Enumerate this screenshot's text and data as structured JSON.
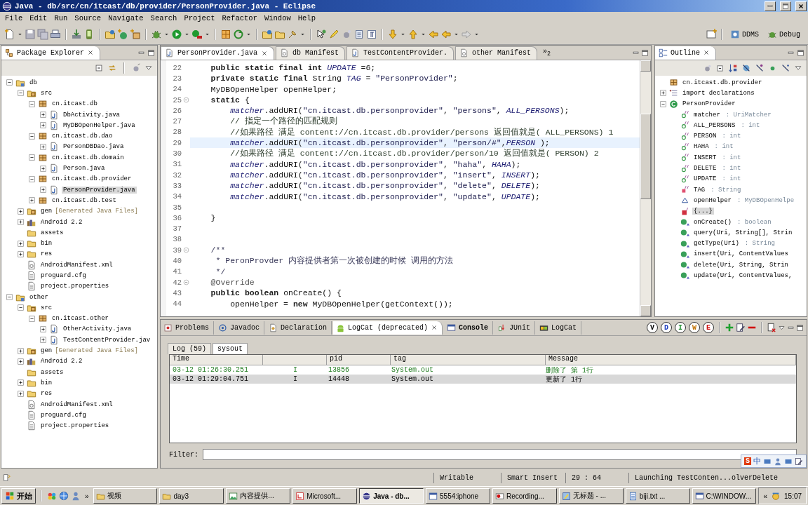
{
  "window": {
    "title": "Java - db/src/cn/itcast/db/provider/PersonProvider.java - Eclipse"
  },
  "menu": [
    "File",
    "Edit",
    "Run",
    "Source",
    "Navigate",
    "Search",
    "Project",
    "Refactor",
    "Window",
    "Help"
  ],
  "perspectives": [
    {
      "label": "DDMS",
      "kind": "ddms",
      "selected": false
    },
    {
      "label": "Debug",
      "kind": "debug",
      "selected": false
    }
  ],
  "package_explorer": {
    "title": "Package Explorer",
    "tree": [
      {
        "label": "db",
        "kind": "project",
        "expanded": true,
        "selected": false,
        "children": [
          {
            "label": "src",
            "kind": "srcfolder",
            "expanded": true,
            "selected": false,
            "children": [
              {
                "label": "cn.itcast.db",
                "kind": "package",
                "expanded": true,
                "selected": false,
                "children": [
                  {
                    "label": "DbActivity.java",
                    "kind": "java",
                    "expanded": false,
                    "selected": false
                  },
                  {
                    "label": "MyDBOpenHelper.java",
                    "kind": "java",
                    "expanded": false,
                    "selected": false
                  }
                ]
              },
              {
                "label": "cn.itcast.db.dao",
                "kind": "package",
                "expanded": true,
                "selected": false,
                "children": [
                  {
                    "label": "PersonDBDao.java",
                    "kind": "java",
                    "expanded": false,
                    "selected": false
                  }
                ]
              },
              {
                "label": "cn.itcast.db.domain",
                "kind": "package",
                "expanded": true,
                "selected": false,
                "children": [
                  {
                    "label": "Person.java",
                    "kind": "java",
                    "expanded": false,
                    "selected": false
                  }
                ]
              },
              {
                "label": "cn.itcast.db.provider",
                "kind": "package",
                "expanded": true,
                "selected": false,
                "children": [
                  {
                    "label": "PersonProvider.java",
                    "kind": "java",
                    "expanded": false,
                    "selected": true
                  }
                ]
              },
              {
                "label": "cn.itcast.db.test",
                "kind": "package",
                "expanded": false,
                "selected": false
              }
            ]
          },
          {
            "label": "gen",
            "note": "[Generated Java Files]",
            "kind": "srcfolder",
            "expanded": false,
            "selected": false
          },
          {
            "label": "Android 2.2",
            "kind": "library",
            "expanded": false,
            "selected": false
          },
          {
            "label": "assets",
            "kind": "folder",
            "selected": false
          },
          {
            "label": "bin",
            "kind": "folder",
            "expanded": false,
            "selected": false
          },
          {
            "label": "res",
            "kind": "folder",
            "expanded": false,
            "selected": false
          },
          {
            "label": "AndroidManifest.xml",
            "kind": "xml",
            "selected": false
          },
          {
            "label": "proguard.cfg",
            "kind": "file",
            "selected": false
          },
          {
            "label": "project.properties",
            "kind": "file",
            "selected": false
          }
        ]
      },
      {
        "label": "other",
        "kind": "project",
        "expanded": true,
        "selected": false,
        "children": [
          {
            "label": "src",
            "kind": "srcfolder",
            "expanded": true,
            "selected": false,
            "children": [
              {
                "label": "cn.itcast.other",
                "kind": "package",
                "expanded": true,
                "selected": false,
                "children": [
                  {
                    "label": "OtherActivity.java",
                    "kind": "java",
                    "expanded": false,
                    "selected": false
                  },
                  {
                    "label": "TestContentProvider.jav",
                    "kind": "java",
                    "expanded": false,
                    "selected": false
                  }
                ]
              }
            ]
          },
          {
            "label": "gen",
            "note": "[Generated Java Files]",
            "kind": "srcfolder",
            "expanded": false,
            "selected": false
          },
          {
            "label": "Android 2.2",
            "kind": "library",
            "expanded": false,
            "selected": false
          },
          {
            "label": "assets",
            "kind": "folder",
            "selected": false
          },
          {
            "label": "bin",
            "kind": "folder",
            "expanded": false,
            "selected": false
          },
          {
            "label": "res",
            "kind": "folder",
            "expanded": false,
            "selected": false
          },
          {
            "label": "AndroidManifest.xml",
            "kind": "xml",
            "selected": false
          },
          {
            "label": "proguard.cfg",
            "kind": "file",
            "selected": false
          },
          {
            "label": "project.properties",
            "kind": "file",
            "selected": false
          }
        ]
      }
    ]
  },
  "editor": {
    "tabs": [
      {
        "label": "PersonProvider.java",
        "kind": "java",
        "selected": true
      },
      {
        "label": "db Manifest",
        "kind": "xml",
        "selected": false
      },
      {
        "label": "TestContentProvider.",
        "kind": "java",
        "selected": false
      },
      {
        "label": "other Manifest",
        "kind": "xml",
        "selected": false
      }
    ],
    "overflow": "»$_{2}$",
    "lines": [
      {
        "number": "22",
        "foldable": false,
        "current": false,
        "segments": [
          {
            "text": "    public static final int ",
            "kind": "keyword"
          },
          {
            "text": "UPDATE",
            "kind": "field"
          },
          {
            "text": " =6;",
            "kind": "plain"
          }
        ]
      },
      {
        "number": "23",
        "foldable": false,
        "current": false,
        "segments": [
          {
            "text": "    private static final ",
            "kind": "keyword"
          },
          {
            "text": "String ",
            "kind": "plain"
          },
          {
            "text": "TAG",
            "kind": "field"
          },
          {
            "text": " = ",
            "kind": "plain"
          },
          {
            "text": "\"PersonProvider\"",
            "kind": "string"
          },
          {
            "text": ";",
            "kind": "plain"
          }
        ]
      },
      {
        "number": "24",
        "foldable": false,
        "current": false,
        "segments": [
          {
            "text": "    MyDBOpenHelper openHelper;",
            "kind": "plain"
          }
        ]
      },
      {
        "number": "25",
        "foldable": true,
        "current": false,
        "segments": [
          {
            "text": "    static",
            "kind": "keyword"
          },
          {
            "text": " {",
            "kind": "plain"
          }
        ]
      },
      {
        "number": "26",
        "foldable": false,
        "current": false,
        "segments": [
          {
            "text": "        matcher",
            "kind": "field"
          },
          {
            "text": ".addURI(",
            "kind": "plain"
          },
          {
            "text": "\"cn.itcast.db.personprovider\"",
            "kind": "string"
          },
          {
            "text": ", ",
            "kind": "plain"
          },
          {
            "text": "\"persons\"",
            "kind": "string"
          },
          {
            "text": ", ",
            "kind": "plain"
          },
          {
            "text": "ALL_PERSONS",
            "kind": "field"
          },
          {
            "text": ");",
            "kind": "plain"
          }
        ]
      },
      {
        "number": "27",
        "foldable": false,
        "current": false,
        "segments": [
          {
            "text": "        // 指定一个路径的匹配规则",
            "kind": "comment"
          }
        ]
      },
      {
        "number": "28",
        "foldable": false,
        "current": false,
        "segments": [
          {
            "text": "        //如果路径 满足 content://cn.itcast.db.provider/persons 返回值就是( ALL_PERSONS) 1",
            "kind": "comment"
          }
        ]
      },
      {
        "number": "29",
        "foldable": false,
        "current": true,
        "segments": [
          {
            "text": "        matcher",
            "kind": "field"
          },
          {
            "text": ".addURI(",
            "kind": "plain"
          },
          {
            "text": "\"cn.itcast.db.personprovider\"",
            "kind": "string"
          },
          {
            "text": ", ",
            "kind": "plain"
          },
          {
            "text": "\"person/#\"",
            "kind": "string"
          },
          {
            "text": ",",
            "kind": "plain"
          },
          {
            "text": "PERSON",
            "kind": "field"
          },
          {
            "text": " );",
            "kind": "plain"
          }
        ]
      },
      {
        "number": "30",
        "foldable": false,
        "current": false,
        "segments": [
          {
            "text": "        //如果路径 满足 content://cn.itcast.db.provider/person/10 返回值就是( PERSON) 2",
            "kind": "comment"
          }
        ]
      },
      {
        "number": "31",
        "foldable": false,
        "current": false,
        "segments": [
          {
            "text": "        matcher",
            "kind": "field"
          },
          {
            "text": ".addURI(",
            "kind": "plain"
          },
          {
            "text": "\"cn.itcast.db.personprovider\"",
            "kind": "string"
          },
          {
            "text": ", ",
            "kind": "plain"
          },
          {
            "text": "\"haha\"",
            "kind": "string"
          },
          {
            "text": ", ",
            "kind": "plain"
          },
          {
            "text": "HAHA",
            "kind": "field"
          },
          {
            "text": ");",
            "kind": "plain"
          }
        ]
      },
      {
        "number": "32",
        "foldable": false,
        "current": false,
        "segments": [
          {
            "text": "        matcher",
            "kind": "field"
          },
          {
            "text": ".addURI(",
            "kind": "plain"
          },
          {
            "text": "\"cn.itcast.db.personprovider\"",
            "kind": "string"
          },
          {
            "text": ", ",
            "kind": "plain"
          },
          {
            "text": "\"insert\"",
            "kind": "string"
          },
          {
            "text": ", ",
            "kind": "plain"
          },
          {
            "text": "INSERT",
            "kind": "field"
          },
          {
            "text": ");",
            "kind": "plain"
          }
        ]
      },
      {
        "number": "33",
        "foldable": false,
        "current": false,
        "segments": [
          {
            "text": "        matcher",
            "kind": "field"
          },
          {
            "text": ".addURI(",
            "kind": "plain"
          },
          {
            "text": "\"cn.itcast.db.personprovider\"",
            "kind": "string"
          },
          {
            "text": ", ",
            "kind": "plain"
          },
          {
            "text": "\"delete\"",
            "kind": "string"
          },
          {
            "text": ", ",
            "kind": "plain"
          },
          {
            "text": "DELETE",
            "kind": "field"
          },
          {
            "text": ");",
            "kind": "plain"
          }
        ]
      },
      {
        "number": "34",
        "foldable": false,
        "current": false,
        "segments": [
          {
            "text": "        matcher",
            "kind": "field"
          },
          {
            "text": ".addURI(",
            "kind": "plain"
          },
          {
            "text": "\"cn.itcast.db.personprovider\"",
            "kind": "string"
          },
          {
            "text": ", ",
            "kind": "plain"
          },
          {
            "text": "\"update\"",
            "kind": "string"
          },
          {
            "text": ", ",
            "kind": "plain"
          },
          {
            "text": "UPDATE",
            "kind": "field"
          },
          {
            "text": ");",
            "kind": "plain"
          }
        ]
      },
      {
        "number": "35",
        "foldable": false,
        "current": false
      },
      {
        "number": "36",
        "foldable": false,
        "current": false,
        "segments": [
          {
            "text": "    }",
            "kind": "plain"
          }
        ]
      },
      {
        "number": "37",
        "foldable": false,
        "current": false
      },
      {
        "number": "38",
        "foldable": false,
        "current": false
      },
      {
        "number": "39",
        "foldable": true,
        "current": false,
        "segments": [
          {
            "text": "    /**",
            "kind": "javadoc"
          }
        ]
      },
      {
        "number": "40",
        "foldable": false,
        "current": false,
        "segments": [
          {
            "text": "     * PeronProvder 内容提供者第一次被创建的时候 调用的方法",
            "kind": "javadoc"
          }
        ]
      },
      {
        "number": "41",
        "foldable": false,
        "current": false,
        "segments": [
          {
            "text": "     */",
            "kind": "javadoc"
          }
        ]
      },
      {
        "number": "42",
        "foldable": true,
        "current": false,
        "segments": [
          {
            "text": "    @Override",
            "kind": "annotation"
          }
        ]
      },
      {
        "number": "43",
        "foldable": false,
        "current": false,
        "segments": [
          {
            "text": "    public boolean ",
            "kind": "keyword"
          },
          {
            "text": "onCreate() {",
            "kind": "plain"
          }
        ]
      },
      {
        "number": "44",
        "foldable": false,
        "current": false,
        "segments": [
          {
            "text": "        openHelper = ",
            "kind": "plain"
          },
          {
            "text": "new ",
            "kind": "keyword"
          },
          {
            "text": "MyDBOpenHelper(getContext());",
            "kind": "plain"
          }
        ]
      }
    ]
  },
  "outline": {
    "title": "Outline",
    "items": [
      {
        "label": "cn.itcast.db.provider",
        "kind": "package",
        "selected": false
      },
      {
        "label": "import declarations",
        "kind": "imports",
        "expanded": false,
        "selected": false
      },
      {
        "label": "PersonProvider",
        "kind": "class",
        "expanded": true,
        "selected": false,
        "children": [
          {
            "label": "matcher",
            "type": ": UriMatcher",
            "kind": "field",
            "selected": false
          },
          {
            "label": "ALL_PERSONS",
            "type": ": int",
            "kind": "field",
            "selected": false
          },
          {
            "label": "PERSON",
            "type": ": int",
            "kind": "field",
            "selected": false
          },
          {
            "label": "HAHA",
            "type": ": int",
            "kind": "field",
            "selected": false
          },
          {
            "label": "INSERT",
            "type": ": int",
            "kind": "field",
            "selected": false
          },
          {
            "label": "DELETE",
            "type": ": int",
            "kind": "field",
            "selected": false
          },
          {
            "label": "UPDATE",
            "type": ": int",
            "kind": "field",
            "selected": false
          },
          {
            "label": "TAG",
            "type": ": String",
            "kind": "privfield",
            "selected": false
          },
          {
            "label": "openHelper",
            "type": ": MyDBOpenHelpe",
            "kind": "pkgfield",
            "selected": false
          },
          {
            "label": "{...}",
            "kind": "block",
            "selected": true
          },
          {
            "label": "onCreate()",
            "type": ": boolean",
            "kind": "method",
            "selected": false
          },
          {
            "label": "query(Uri, String[], Strin",
            "kind": "method",
            "selected": false
          },
          {
            "label": "getType(Uri)",
            "type": ": String",
            "kind": "method",
            "selected": false
          },
          {
            "label": "insert(Uri, ContentValues",
            "kind": "method",
            "selected": false
          },
          {
            "label": "delete(Uri, String, Strin",
            "kind": "method",
            "selected": false
          },
          {
            "label": "update(Uri, ContentValues,",
            "kind": "method",
            "selected": false
          }
        ]
      }
    ]
  },
  "bottom_panel": {
    "tabs": [
      {
        "label": "Problems",
        "kind": "problems",
        "selected": false,
        "changed": false
      },
      {
        "label": "Javadoc",
        "kind": "javadoc",
        "selected": false,
        "changed": false
      },
      {
        "label": "Declaration",
        "kind": "declaration",
        "selected": false,
        "changed": false
      },
      {
        "label": "LogCat (deprecated)",
        "kind": "android",
        "selected": true,
        "changed": false
      },
      {
        "label": "Console",
        "kind": "console",
        "selected": false,
        "changed": true
      },
      {
        "label": "JUnit",
        "kind": "junit",
        "selected": false,
        "changed": false
      },
      {
        "label": "LogCat",
        "kind": "logcat",
        "selected": false,
        "changed": false
      }
    ],
    "log_levels": [
      {
        "letter": "V",
        "color": "#000000"
      },
      {
        "letter": "D",
        "color": "#1f3fbf"
      },
      {
        "letter": "I",
        "color": "#1f8f2f"
      },
      {
        "letter": "W",
        "color": "#c07000"
      },
      {
        "letter": "E",
        "color": "#d01010"
      }
    ],
    "subtabs": [
      {
        "label": "Log (59)",
        "selected": false
      },
      {
        "label": "sysout",
        "selected": true
      }
    ],
    "columns": [
      {
        "heading": "Time"
      },
      {},
      {
        "heading": "pid"
      },
      {
        "heading": "tag"
      },
      {
        "heading": "Message"
      }
    ],
    "rows": [
      {
        "cells": [
          "03-12 01:26:30.251",
          "I",
          "13856",
          "System.out",
          "删除了 第 1行"
        ],
        "selected": false
      },
      {
        "cells": [
          "03-12 01:29:04.751",
          "I",
          "14448",
          "System.out",
          "更新了 1行"
        ],
        "selected": true
      }
    ],
    "filter_label": "Filter:"
  },
  "ime_bar": {
    "logo": "S",
    "mode": "中"
  },
  "status_bar": {
    "fields": [
      "Writable",
      "Smart Insert",
      "29 : 64",
      "Launching TestConten...olverDelete"
    ]
  },
  "taskbar": {
    "start": "开始",
    "more": "»",
    "items": [
      {
        "label": "视频",
        "kind": "folder",
        "selected": false
      },
      {
        "label": "day3",
        "kind": "folder",
        "selected": false
      },
      {
        "label": "内容提供...",
        "kind": "image",
        "selected": false
      },
      {
        "label": "Microsoft...",
        "kind": "office",
        "selected": false
      },
      {
        "label": "Java - db...",
        "kind": "eclipse",
        "selected": true
      },
      {
        "label": "5554:iphone",
        "kind": "window",
        "selected": false
      },
      {
        "label": "Recording...",
        "kind": "record",
        "selected": false
      },
      {
        "label": "无标题 - ...",
        "kind": "paint",
        "selected": false
      },
      {
        "label": "biji.txt ...",
        "kind": "notepad",
        "selected": false
      },
      {
        "label": "C:\\WINDOW...",
        "kind": "console",
        "selected": false
      }
    ],
    "tray_more": "«",
    "clock": "15:07"
  }
}
